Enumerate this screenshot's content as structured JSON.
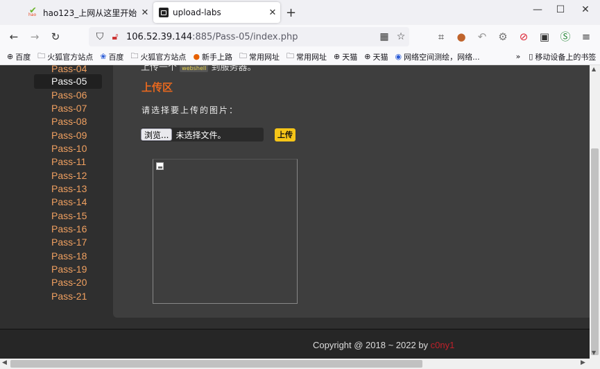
{
  "tabs": [
    {
      "title": "hao123_上网从这里开始",
      "close": "✕",
      "icon": "hao123-icon"
    },
    {
      "title": "upload-labs",
      "close": "✕",
      "icon": "upload-labs-icon"
    }
  ],
  "new_tab": "+",
  "window_controls": {
    "minimize": "—",
    "maximize": "☐",
    "close": "✕"
  },
  "nav": {
    "back": "←",
    "forward": "→",
    "reload": "↻"
  },
  "url": {
    "host": "106.52.39.144",
    "rest": ":885/Pass-05/index.php"
  },
  "bookmarks": [
    {
      "label": "百度",
      "icon": "globe-icon"
    },
    {
      "label": "火狐官方站点",
      "icon": "folder-icon"
    },
    {
      "label": "百度",
      "icon": "paw-icon"
    },
    {
      "label": "火狐官方站点",
      "icon": "folder-icon"
    },
    {
      "label": "新手上路",
      "icon": "firefox-icon"
    },
    {
      "label": "常用网址",
      "icon": "folder-icon"
    },
    {
      "label": "常用网址",
      "icon": "folder-icon"
    },
    {
      "label": "天猫",
      "icon": "globe-icon"
    },
    {
      "label": "天猫",
      "icon": "globe-icon"
    },
    {
      "label": "网络空间测绘，网络...",
      "icon": "shield-icon"
    }
  ],
  "bookmarks_more": "»",
  "mobile_bookmarks": "移动设备上的书签",
  "sidebar": {
    "items": [
      "Pass-04",
      "Pass-05",
      "Pass-06",
      "Pass-07",
      "Pass-08",
      "Pass-09",
      "Pass-10",
      "Pass-11",
      "Pass-12",
      "Pass-13",
      "Pass-14",
      "Pass-15",
      "Pass-16",
      "Pass-17",
      "Pass-18",
      "Pass-19",
      "Pass-20",
      "Pass-21"
    ],
    "active": "Pass-05"
  },
  "main": {
    "top_text_pre": "上传一个",
    "top_code": "webshell",
    "top_text_post": "到服务器。",
    "section_title": "上传区",
    "prompt": "请选择要上传的图片：",
    "browse_label": "浏览...",
    "no_file": "未选择文件。",
    "upload_label": "上传"
  },
  "footer": {
    "text": "Copyright @ 2018 ~ 2022 by ",
    "author": "c0ny1"
  },
  "colors": {
    "accent": "#e8681e",
    "link": "#f0a060",
    "upload_button": "#f5c518",
    "author": "#c0202a"
  }
}
